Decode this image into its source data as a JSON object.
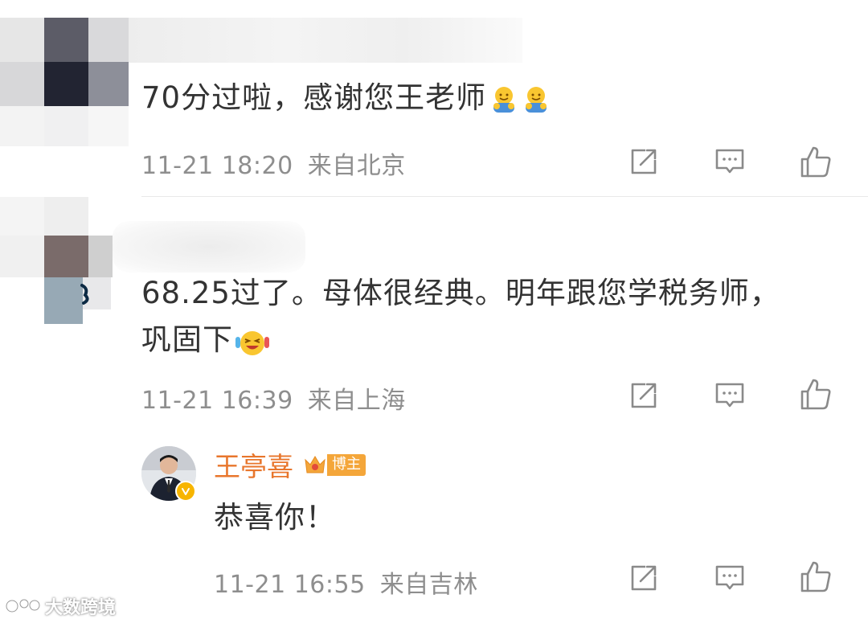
{
  "comments": [
    {
      "text": "70分过啦，感谢您王老师",
      "time": "11-21 18:20",
      "location": "来自北京"
    },
    {
      "text_line1": "68.25过了。母体很经典。明年跟您学税务师，",
      "text_line2": "巩固下",
      "time": "11-21 16:39",
      "location": "来自上海"
    }
  ],
  "reply": {
    "author": "王亭喜",
    "badge": "博主",
    "text": "恭喜你！",
    "time": "11-21 16:55",
    "location": "来自吉林"
  },
  "icons": {
    "share": "share-icon",
    "comment": "comment-icon",
    "like": "thumbs-up-icon"
  },
  "colors": {
    "author_name": "#e8762c",
    "meta_gray": "#8e8e8e",
    "badge_bg": "#f4a63a",
    "icon_gray": "#8a8a8a"
  },
  "watermark": "大数跨境"
}
